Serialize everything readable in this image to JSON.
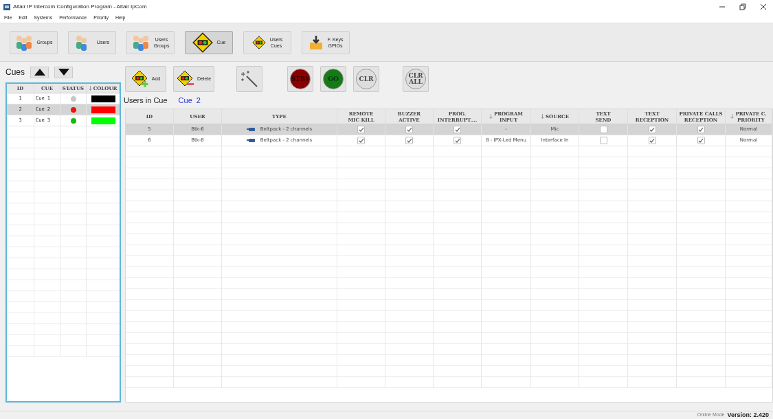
{
  "window": {
    "title": "Altair IP Intercom Configuration Program - Altair IpCom"
  },
  "menu": [
    "File",
    "Edit",
    "Systems",
    "Performance",
    "Priority",
    "Help"
  ],
  "toolbar": [
    {
      "kind": "groups",
      "label": "Groups",
      "selected": false
    },
    {
      "kind": "users",
      "label": "Users",
      "selected": false
    },
    {
      "kind": "users-groups",
      "label": "Users\nGroups",
      "selected": false
    },
    {
      "kind": "cue",
      "label": "Cue",
      "selected": true
    },
    {
      "kind": "users-cues",
      "label": "Users\nCues",
      "selected": false
    },
    {
      "kind": "keys",
      "label": "F. Keys\nGPIOs",
      "selected": false
    }
  ],
  "cues_panel": {
    "title": "Cues",
    "columns": [
      {
        "label": "ID",
        "sort": false
      },
      {
        "label": "CUE",
        "sort": false
      },
      {
        "label": "STATUS",
        "sort": false
      },
      {
        "label": "COLOUR",
        "sort": true
      }
    ],
    "rows": [
      {
        "id": "1",
        "cue": "Cue 1",
        "status": {
          "color": "#c8c8c8"
        },
        "color": "#000000",
        "selected": false
      },
      {
        "id": "2",
        "cue": "Cue 2",
        "status": {
          "color": "#ee1111"
        },
        "color": "#ff0000",
        "selected": true
      },
      {
        "id": "3",
        "cue": "Cue 3",
        "status": {
          "color": "#11bb11"
        },
        "color": "#00ff00",
        "selected": false
      }
    ]
  },
  "actions": [
    {
      "kind": "add",
      "label": "Add"
    },
    {
      "kind": "delete",
      "label": "Delete"
    },
    {
      "kind": "wand"
    },
    {
      "kind": "stby",
      "label": "STBY"
    },
    {
      "kind": "go",
      "label": "GO"
    },
    {
      "kind": "clr",
      "label": "CLR"
    },
    {
      "kind": "clrall",
      "label": "CLR\nALL"
    }
  ],
  "users_in_cue": {
    "title": "Users in Cue",
    "cue": "Cue  2",
    "columns": [
      {
        "label": "ID",
        "sort": false
      },
      {
        "label": "USER",
        "sort": false
      },
      {
        "label": "TYPE",
        "sort": false
      },
      {
        "label": "REMOTE\nMIC KILL",
        "sort": false
      },
      {
        "label": "BUZZER\nACTIVE",
        "sort": false
      },
      {
        "label": "PROG.\nINTERRUPT....",
        "sort": false
      },
      {
        "label": "PROGRAM\nINPUT",
        "sort": true
      },
      {
        "label": "SOURCE",
        "sort": true
      },
      {
        "label": "TEXT\nSEND",
        "sort": false
      },
      {
        "label": "TEXT\nRECEPTION",
        "sort": false
      },
      {
        "label": "PRIVATE CALLS\nRECEPTION",
        "sort": false
      },
      {
        "label": "PRIVATE C.\nPRIORITY",
        "sort": true
      }
    ],
    "rows": [
      {
        "selected": true,
        "cells": [
          {
            "kind": "text",
            "text": "5"
          },
          {
            "kind": "text",
            "text": "Btk-6"
          },
          {
            "kind": "device",
            "text": "Beltpack - 2 channels"
          },
          {
            "kind": "check",
            "checked": true
          },
          {
            "kind": "check",
            "checked": true
          },
          {
            "kind": "check",
            "checked": true
          },
          {
            "kind": "text",
            "text": "-"
          },
          {
            "kind": "text",
            "text": "Mic"
          },
          {
            "kind": "check",
            "checked": false
          },
          {
            "kind": "check",
            "checked": true
          },
          {
            "kind": "check",
            "checked": true
          },
          {
            "kind": "text",
            "text": "Normal"
          }
        ]
      },
      {
        "selected": false,
        "cells": [
          {
            "kind": "text",
            "text": "6"
          },
          {
            "kind": "text",
            "text": "Btk-8"
          },
          {
            "kind": "device",
            "text": "Beltpack - 2 channels"
          },
          {
            "kind": "check",
            "checked": true
          },
          {
            "kind": "check",
            "checked": true
          },
          {
            "kind": "check",
            "checked": true
          },
          {
            "kind": "text",
            "text": "8 - IPX-Led Menu"
          },
          {
            "kind": "text",
            "text": "Interface In"
          },
          {
            "kind": "check",
            "checked": false
          },
          {
            "kind": "check",
            "checked": true
          },
          {
            "kind": "check",
            "checked": true
          },
          {
            "kind": "text",
            "text": "Normal"
          }
        ]
      }
    ]
  },
  "status_bar": {
    "mode": "Online Mode",
    "version": "Version: 2.420"
  }
}
